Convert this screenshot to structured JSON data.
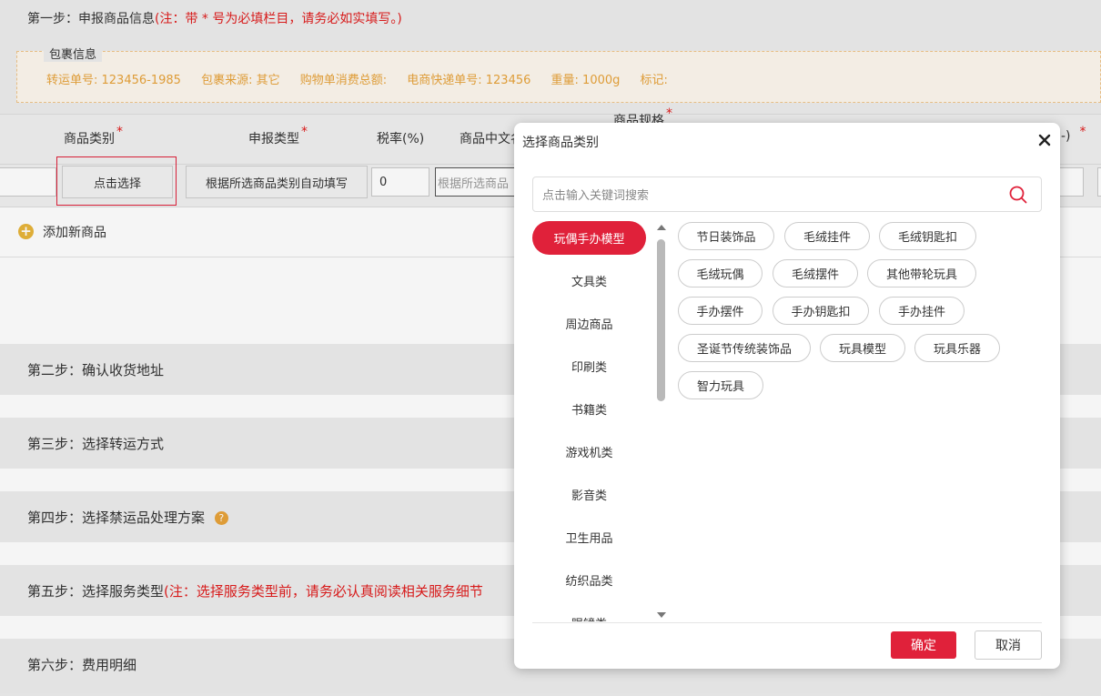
{
  "step1": {
    "title": "第一步：申报商品信息",
    "note": "(注：带 * 号为必填栏目，请务必如实填写。)"
  },
  "package": {
    "legend": "包裹信息",
    "transfer_no": "转运单号: 123456-1985",
    "source": "包裹来源: 其它",
    "total": "购物单消费总额:",
    "express_no": "电商快递单号: 123456",
    "weight": "重量: 1000g",
    "mark": "标记:"
  },
  "table": {
    "headers": {
      "category": "商品类别",
      "declare_type": "申报类型",
      "tax_rate": "税率(%)",
      "cn_name": "商品中文名",
      "spec": "商品规格",
      "trailing": "-)"
    },
    "row": {
      "select_button": "点击选择",
      "autofill_button": "根据所选商品类别自动填写",
      "tax_value": "0",
      "name_placeholder": "根据所选商品"
    },
    "add_product": "添加新商品"
  },
  "steps": [
    {
      "title": "第二步：确认收货地址"
    },
    {
      "title": "第三步：选择转运方式"
    },
    {
      "title": "第四步：选择禁运品处理方案"
    },
    {
      "title": "第五步：选择服务类型",
      "note": "(注：选择服务类型前，请务必认真阅读相关服务细节"
    },
    {
      "title": "第六步：费用明细"
    }
  ],
  "modal": {
    "title": "选择商品类别",
    "search_placeholder": "点击输入关键词搜索",
    "categories": [
      "玩偶手办模型",
      "文具类",
      "周边商品",
      "印刷类",
      "书籍类",
      "游戏机类",
      "影音类",
      "卫生用品",
      "纺织品类",
      "眼镜类"
    ],
    "active_category": "玩偶手办模型",
    "tags": [
      "节日装饰品",
      "毛绒挂件",
      "毛绒钥匙扣",
      "毛绒玩偶",
      "毛绒摆件",
      "其他带轮玩具",
      "手办摆件",
      "手办钥匙扣",
      "手办挂件",
      "圣诞节传统装饰品",
      "玩具模型",
      "玩具乐器",
      "智力玩具"
    ],
    "ok": "确定",
    "cancel": "取消"
  },
  "colors": {
    "accent": "#e0213a",
    "orange": "#e8a33a",
    "required": "#e01c1c"
  }
}
